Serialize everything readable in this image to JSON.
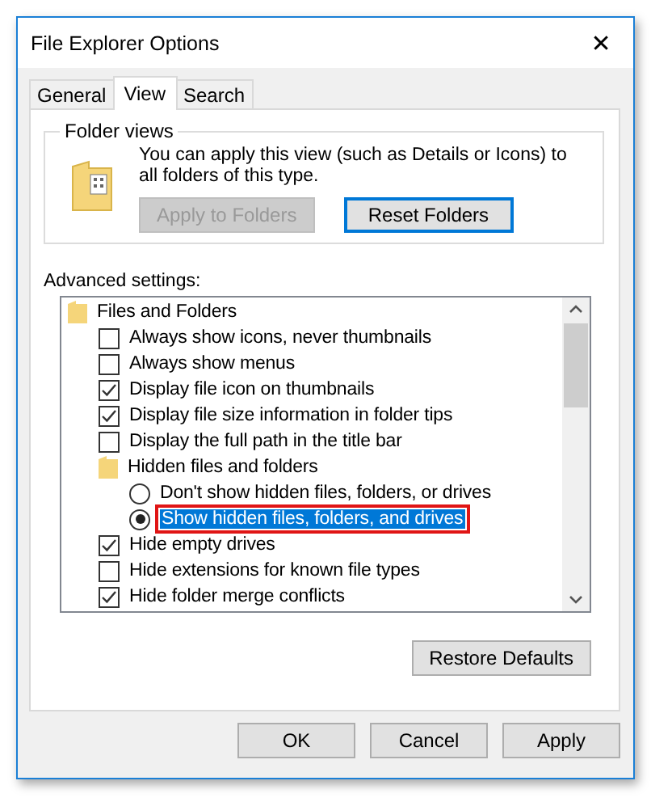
{
  "window": {
    "title": "File Explorer Options",
    "close": "✕"
  },
  "tabs": [
    {
      "label": "General",
      "selected": false
    },
    {
      "label": "View",
      "selected": true
    },
    {
      "label": "Search",
      "selected": false
    }
  ],
  "folder_views": {
    "title": "Folder views",
    "description": "You can apply this view (such as Details or Icons) to all folders of this type.",
    "buttons": [
      {
        "label": "Apply to Folders",
        "disabled": true
      },
      {
        "label": "Reset Folders",
        "disabled": false
      }
    ]
  },
  "advanced": {
    "label": "Advanced settings:",
    "tree": [
      {
        "kind": "folder",
        "label": "Files and Folders",
        "children": [
          {
            "kind": "checkbox",
            "label": "Always show icons, never thumbnails",
            "checked": false
          },
          {
            "kind": "checkbox",
            "label": "Always show menus",
            "checked": false
          },
          {
            "kind": "checkbox",
            "label": "Display file icon on thumbnails",
            "checked": true
          },
          {
            "kind": "checkbox",
            "label": "Display file size information in folder tips",
            "checked": true
          },
          {
            "kind": "checkbox",
            "label": "Display the full path in the title bar",
            "checked": false
          },
          {
            "kind": "folder",
            "label": "Hidden files and folders",
            "children": [
              {
                "kind": "radio",
                "label": "Don't show hidden files, folders, or drives",
                "selected": false,
                "annotated": false
              },
              {
                "kind": "radio",
                "label": "Show hidden files, folders, and drives",
                "selected": true,
                "annotated": true
              }
            ]
          },
          {
            "kind": "checkbox",
            "label": "Hide empty drives",
            "checked": true
          },
          {
            "kind": "checkbox",
            "label": "Hide extensions for known file types",
            "checked": false
          },
          {
            "kind": "checkbox",
            "label": "Hide folder merge conflicts",
            "checked": true
          }
        ]
      }
    ],
    "restore_button": "Restore Defaults"
  },
  "buttons": [
    {
      "label": "OK",
      "disabled": false
    },
    {
      "label": "Cancel",
      "disabled": false
    },
    {
      "label": "Apply",
      "disabled": false
    }
  ]
}
